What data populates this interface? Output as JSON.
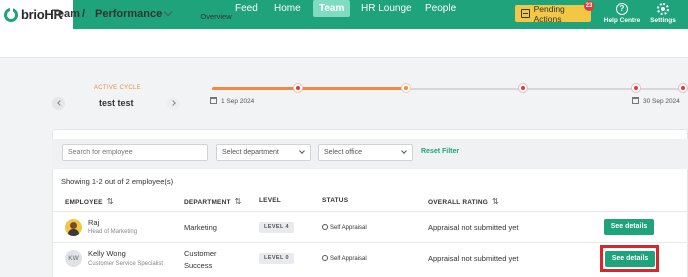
{
  "brand": {
    "logo_text": "brio",
    "logo_suffix": "HR"
  },
  "nav": {
    "items": [
      "Feed",
      "Home",
      "Team",
      "HR Lounge",
      "People"
    ],
    "active": "Team"
  },
  "pending": {
    "label": "Pending Actions",
    "count": "23"
  },
  "help": {
    "label": "Help Centre",
    "glyph": "?"
  },
  "settings": {
    "label": "Settings"
  },
  "breadcrumb": {
    "section": "Team",
    "separator": "/",
    "page": "Performance"
  },
  "tabs": {
    "overview": "Overview"
  },
  "cycle": {
    "label": "ACTIVE CYCLE",
    "name": "test test",
    "start_date": "1 Sep 2024",
    "end_date": "30 Sep 2024",
    "progress": 0.41
  },
  "filters": {
    "search_placeholder": "Search for employee",
    "department_placeholder": "Select department",
    "office_placeholder": "Select office",
    "reset_label": "Reset Filter"
  },
  "table": {
    "count_text": "Showing 1-2 out of 2 employee(s)",
    "headers": {
      "employee": "EMPLOYEE",
      "department": "DEPARTMENT",
      "level": "LEVEL",
      "status": "STATUS",
      "rating": "OVERALL RATING",
      "sort_glyph": "⇅"
    },
    "rows": [
      {
        "name": "Raj",
        "role": "Head of Marketing",
        "department": "Marketing",
        "department_line2": "",
        "level": "LEVEL 4",
        "status": "Self Appraisal",
        "rating": "Appraisal not submitted yet",
        "action": "See details"
      },
      {
        "initials": "KW",
        "name": "Kelly Wong",
        "role": "Customer Service Specialist",
        "department": "Customer",
        "department_line2": "Success",
        "level": "LEVEL 0",
        "status": "Self Appraisal",
        "rating": "Appraisal not submitted yet",
        "action": "See details"
      }
    ]
  },
  "colors": {
    "brand_green": "#1fa37a",
    "accent_orange": "#f08a42",
    "pending_yellow": "#f2c744",
    "highlight_red": "#d9262d"
  }
}
